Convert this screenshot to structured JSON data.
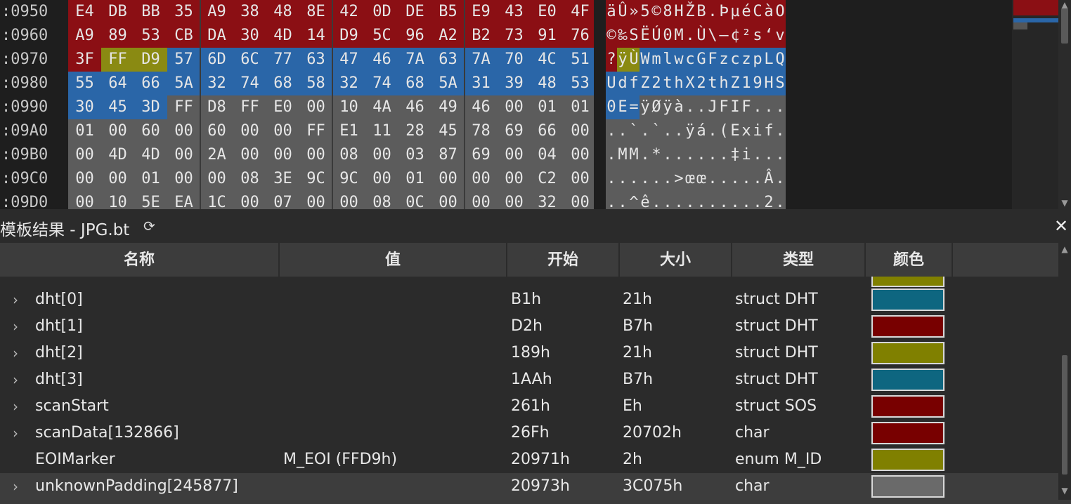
{
  "hex": {
    "rows": [
      {
        "addr": ":0950",
        "bytes": [
          "E4",
          "DB",
          "BB",
          "35",
          "A9",
          "38",
          "48",
          "8E",
          "42",
          "0D",
          "DE",
          "B5",
          "E9",
          "43",
          "E0",
          "4F"
        ],
        "hl": [
          "r",
          "r",
          "r",
          "r",
          "r",
          "r",
          "r",
          "r",
          "r",
          "r",
          "r",
          "r",
          "r",
          "r",
          "r",
          "r"
        ],
        "ascii": "äÛ»5©8HŽB.ÞµéCàO",
        "ahl": [
          "r",
          "r",
          "r",
          "r",
          "r",
          "r",
          "r",
          "r",
          "r",
          "r",
          "r",
          "r",
          "r",
          "r",
          "r",
          "r"
        ]
      },
      {
        "addr": ":0960",
        "bytes": [
          "A9",
          "89",
          "53",
          "CB",
          "DA",
          "30",
          "4D",
          "14",
          "D9",
          "5C",
          "96",
          "A2",
          "B2",
          "73",
          "91",
          "76"
        ],
        "hl": [
          "r",
          "r",
          "r",
          "r",
          "r",
          "r",
          "r",
          "r",
          "r",
          "r",
          "r",
          "r",
          "r",
          "r",
          "r",
          "r"
        ],
        "ascii": "©‰SËÚ0M.Ù\\–¢²s‘v",
        "ahl": [
          "r",
          "r",
          "r",
          "r",
          "r",
          "r",
          "r",
          "r",
          "r",
          "r",
          "r",
          "r",
          "r",
          "r",
          "r",
          "r"
        ]
      },
      {
        "addr": ":0970",
        "bytes": [
          "3F",
          "FF",
          "D9",
          "57",
          "6D",
          "6C",
          "77",
          "63",
          "47",
          "46",
          "7A",
          "63",
          "7A",
          "70",
          "4C",
          "51"
        ],
        "hl": [
          "r",
          "y",
          "y",
          "b",
          "b",
          "b",
          "b",
          "b",
          "b",
          "b",
          "b",
          "b",
          "b",
          "b",
          "b",
          "b"
        ],
        "ascii": "?ÿÙWmlwcGFzczpLQ",
        "ahl": [
          "r",
          "y",
          "y",
          "b",
          "b",
          "b",
          "b",
          "b",
          "b",
          "b",
          "b",
          "b",
          "b",
          "b",
          "b",
          "b"
        ]
      },
      {
        "addr": ":0980",
        "bytes": [
          "55",
          "64",
          "66",
          "5A",
          "32",
          "74",
          "68",
          "58",
          "32",
          "74",
          "68",
          "5A",
          "31",
          "39",
          "48",
          "53"
        ],
        "hl": [
          "b",
          "b",
          "b",
          "b",
          "b",
          "b",
          "b",
          "b",
          "b",
          "b",
          "b",
          "b",
          "b",
          "b",
          "b",
          "b"
        ],
        "ascii": "UdfZ2thX2thZ19HS",
        "ahl": [
          "b",
          "b",
          "b",
          "b",
          "b",
          "b",
          "b",
          "b",
          "b",
          "b",
          "b",
          "b",
          "b",
          "b",
          "b",
          "b"
        ]
      },
      {
        "addr": ":0990",
        "bytes": [
          "30",
          "45",
          "3D",
          "FF",
          "D8",
          "FF",
          "E0",
          "00",
          "10",
          "4A",
          "46",
          "49",
          "46",
          "00",
          "01",
          "01"
        ],
        "hl": [
          "b",
          "b",
          "b",
          "g",
          "g",
          "g",
          "g",
          "g",
          "g",
          "g",
          "g",
          "g",
          "g",
          "g",
          "g",
          "g"
        ],
        "ascii": "0E=ÿØÿà..JFIF...",
        "ahl": [
          "b",
          "b",
          "b",
          "g",
          "g",
          "g",
          "g",
          "g",
          "g",
          "g",
          "g",
          "g",
          "g",
          "g",
          "g",
          "g"
        ]
      },
      {
        "addr": ":09A0",
        "bytes": [
          "01",
          "00",
          "60",
          "00",
          "60",
          "00",
          "00",
          "FF",
          "E1",
          "11",
          "28",
          "45",
          "78",
          "69",
          "66",
          "00"
        ],
        "hl": [
          "g",
          "g",
          "g",
          "g",
          "g",
          "g",
          "g",
          "g",
          "g",
          "g",
          "g",
          "g",
          "g",
          "g",
          "g",
          "g"
        ],
        "ascii": "..`.`..ÿá.(Exif.",
        "ahl": [
          "g",
          "g",
          "g",
          "g",
          "g",
          "g",
          "g",
          "g",
          "g",
          "g",
          "g",
          "g",
          "g",
          "g",
          "g",
          "g"
        ]
      },
      {
        "addr": ":09B0",
        "bytes": [
          "00",
          "4D",
          "4D",
          "00",
          "2A",
          "00",
          "00",
          "00",
          "08",
          "00",
          "03",
          "87",
          "69",
          "00",
          "04",
          "00"
        ],
        "hl": [
          "g",
          "g",
          "g",
          "g",
          "g",
          "g",
          "g",
          "g",
          "g",
          "g",
          "g",
          "g",
          "g",
          "g",
          "g",
          "g"
        ],
        "ascii": ".MM.*......‡i...",
        "ahl": [
          "g",
          "g",
          "g",
          "g",
          "g",
          "g",
          "g",
          "g",
          "g",
          "g",
          "g",
          "g",
          "g",
          "g",
          "g",
          "g"
        ]
      },
      {
        "addr": ":09C0",
        "bytes": [
          "00",
          "00",
          "01",
          "00",
          "00",
          "08",
          "3E",
          "9C",
          "9C",
          "00",
          "01",
          "00",
          "00",
          "00",
          "C2",
          "00"
        ],
        "hl": [
          "g",
          "g",
          "g",
          "g",
          "g",
          "g",
          "g",
          "g",
          "g",
          "g",
          "g",
          "g",
          "g",
          "g",
          "g",
          "g"
        ],
        "ascii": "......>œœ.....Â.",
        "ahl": [
          "g",
          "g",
          "g",
          "g",
          "g",
          "g",
          "g",
          "g",
          "g",
          "g",
          "g",
          "g",
          "g",
          "g",
          "g",
          "g"
        ]
      },
      {
        "addr": ":09D0",
        "bytes": [
          "00",
          "10",
          "5E",
          "EA",
          "1C",
          "00",
          "07",
          "00",
          "00",
          "08",
          "0C",
          "00",
          "00",
          "00",
          "32",
          "00"
        ],
        "hl": [
          "g",
          "g",
          "g",
          "g",
          "g",
          "g",
          "g",
          "g",
          "g",
          "g",
          "g",
          "g",
          "g",
          "g",
          "g",
          "g"
        ],
        "ascii": "..^ê..........2.",
        "ahl": [
          "g",
          "g",
          "g",
          "g",
          "g",
          "g",
          "g",
          "g",
          "g",
          "g",
          "g",
          "g",
          "g",
          "g",
          "g",
          "g"
        ]
      }
    ],
    "colors": {
      "r": "#8b0f14",
      "y": "#8a8a12",
      "b": "#2a66a8",
      "g": "#5c5c5c"
    }
  },
  "panel": {
    "title": "模板结果 - JPG.bt",
    "refresh_icon": "refresh-icon",
    "close_icon": "close-icon"
  },
  "columns": [
    "名称",
    "值",
    "开始",
    "大小",
    "类型",
    "颜色"
  ],
  "rows": [
    {
      "name": "dht[0]",
      "value": "",
      "start": "B1h",
      "size": "21h",
      "type": "struct DHT",
      "color": "#0e6680",
      "expandable": true
    },
    {
      "name": "dht[1]",
      "value": "",
      "start": "D2h",
      "size": "B7h",
      "type": "struct DHT",
      "color": "#780000",
      "expandable": true
    },
    {
      "name": "dht[2]",
      "value": "",
      "start": "189h",
      "size": "21h",
      "type": "struct DHT",
      "color": "#808000",
      "expandable": true
    },
    {
      "name": "dht[3]",
      "value": "",
      "start": "1AAh",
      "size": "B7h",
      "type": "struct DHT",
      "color": "#0e6680",
      "expandable": true
    },
    {
      "name": "scanStart",
      "value": "",
      "start": "261h",
      "size": "Eh",
      "type": "struct SOS",
      "color": "#780000",
      "expandable": true
    },
    {
      "name": "scanData[132866]",
      "value": "",
      "start": "26Fh",
      "size": "20702h",
      "type": "char",
      "color": "#780000",
      "expandable": true
    },
    {
      "name": "EOIMarker",
      "value": "M_EOI (FFD9h)",
      "start": "20971h",
      "size": "2h",
      "type": "enum M_ID",
      "color": "#808000",
      "expandable": false
    },
    {
      "name": "unknownPadding[245877]",
      "value": "",
      "start": "20973h",
      "size": "3C075h",
      "type": "char",
      "color": "#6a6a6a",
      "expandable": true
    }
  ],
  "partial_top_row_color": "#808000"
}
